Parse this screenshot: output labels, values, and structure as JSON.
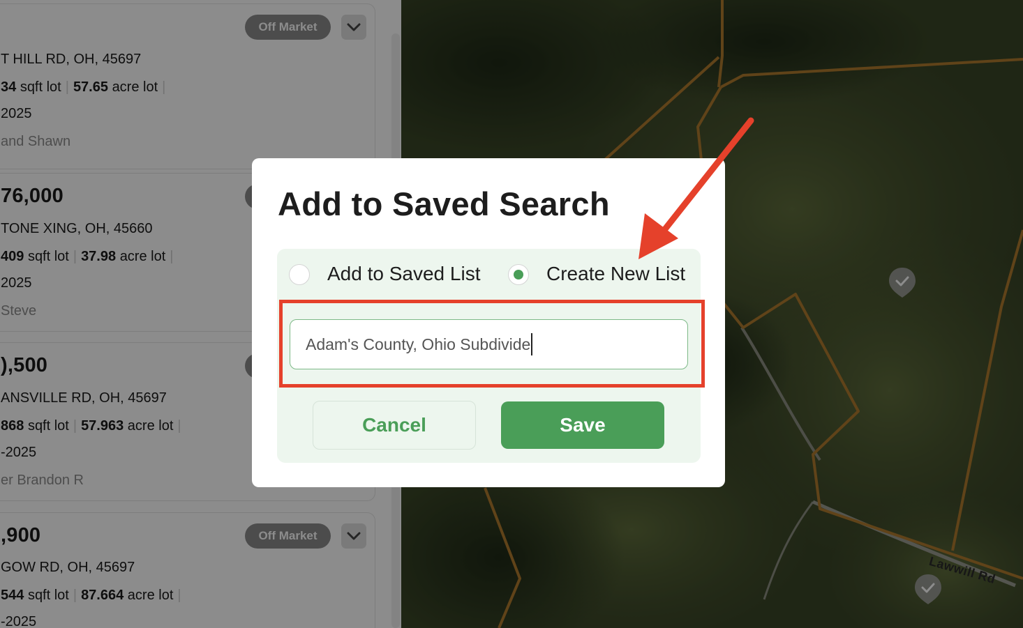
{
  "listings": [
    {
      "price": "",
      "address": "T HILL RD, OH, 45697",
      "sqft": "34",
      "sqft_label": "sqft lot",
      "acres": "57.65",
      "acres_label": "acre lot",
      "date": "2025",
      "owner": "and Shawn",
      "badge": "Off Market"
    },
    {
      "price": "76,000",
      "address": "TONE XING, OH, 45660",
      "sqft": "409",
      "sqft_label": "sqft lot",
      "acres": "37.98",
      "acres_label": "acre lot",
      "date": "2025",
      "owner": "Steve",
      "badge": ""
    },
    {
      "price": "),500",
      "address": "ANSVILLE RD, OH, 45697",
      "sqft": "868",
      "sqft_label": "sqft lot",
      "acres": "57.963",
      "acres_label": "acre lot",
      "date": "-2025",
      "owner": "er Brandon R",
      "badge": ""
    },
    {
      "price": ",900",
      "address": "GOW RD, OH, 45697",
      "sqft": "544",
      "sqft_label": "sqft lot",
      "acres": "87.664",
      "acres_label": "acre lot",
      "date": "-2025",
      "owner": "",
      "badge": "Off Market"
    }
  ],
  "map": {
    "road_label": "Lawwill Rd",
    "parcel_color": "#b07a2e",
    "marker_icon": "check-icon"
  },
  "modal": {
    "title": "Add to Saved Search",
    "options": [
      {
        "label": "Add to Saved List",
        "selected": false
      },
      {
        "label": "Create New List",
        "selected": true
      }
    ],
    "list_name_value": "Adam's County, Ohio Subdivide",
    "cancel_label": "Cancel",
    "save_label": "Save"
  },
  "annotation": {
    "color": "#e5412b"
  },
  "colors": {
    "accent": "#4a9e58",
    "accent_light": "#edf6ee",
    "badge": "#8a8a8a"
  }
}
